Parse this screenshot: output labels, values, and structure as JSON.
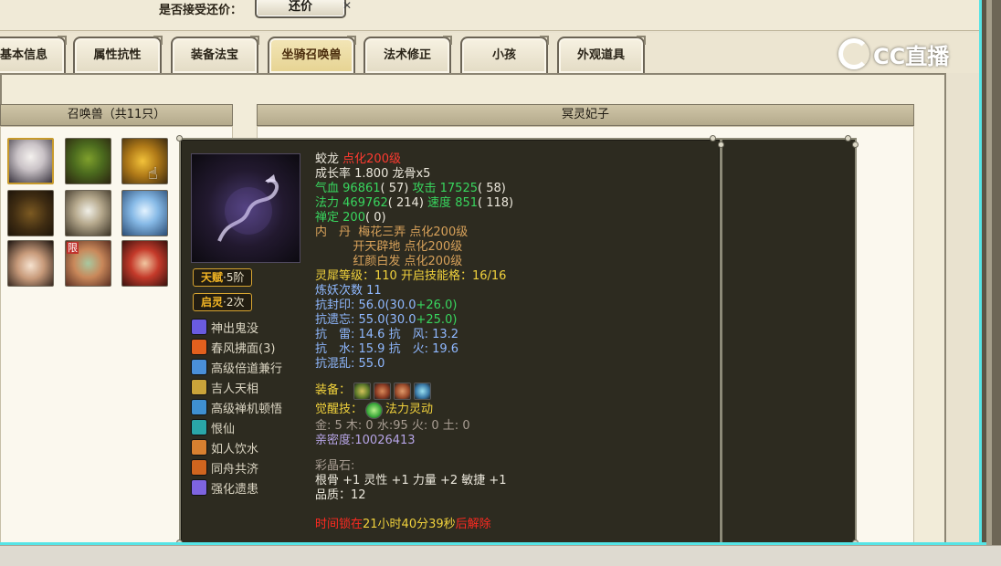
{
  "header": {
    "bargain_label": "是否接受还价：",
    "counter_button": "还价"
  },
  "tabs": [
    {
      "label": "基本信息"
    },
    {
      "label": "属性抗性"
    },
    {
      "label": "装备法宝"
    },
    {
      "label": "坐骑召唤兽",
      "active": true
    },
    {
      "label": "法术修正"
    },
    {
      "label": "小孩"
    },
    {
      "label": "外观道具"
    }
  ],
  "watermark": {
    "text": "CC直播"
  },
  "left_panel": {
    "title": "召唤兽（共11只）",
    "pets": [
      {
        "icon": "white-twin-beast-portrait",
        "selected": true
      },
      {
        "icon": "green-ogre-portrait"
      },
      {
        "icon": "golden-beast-portrait"
      },
      {
        "icon": "brown-beast-portrait"
      },
      {
        "icon": "armored-warrior-portrait"
      },
      {
        "icon": "ice-crystal-portrait"
      },
      {
        "icon": "lady-portrait"
      },
      {
        "icon": "fan-monk-portrait",
        "tag": "限"
      },
      {
        "icon": "red-kid-portrait"
      }
    ]
  },
  "right_panel": {
    "title": "冥灵妃子"
  },
  "tooltip": {
    "talent": {
      "name": "天赋",
      "level": "·5阶"
    },
    "enlighten": {
      "name": "启灵",
      "level": "·2次"
    },
    "skills": [
      {
        "name": "神出鬼没",
        "icon": "ghost-skill-icon",
        "color": "#6a5be0"
      },
      {
        "name": "春风拂面(3)",
        "icon": "flame-skill-icon",
        "color": "#e2601e"
      },
      {
        "name": "高级倍道兼行",
        "icon": "dash-skill-icon",
        "color": "#4a8fd8"
      },
      {
        "name": "吉人天相",
        "icon": "fortune-skill-icon",
        "color": "#c9a33a"
      },
      {
        "name": "高级禅机顿悟",
        "icon": "zen-skill-icon",
        "color": "#3f8fd0"
      },
      {
        "name": "恨仙",
        "icon": "ring-skill-icon",
        "color": "#2aa6a8"
      },
      {
        "name": "如人饮水",
        "icon": "water-skill-icon",
        "color": "#d88030"
      },
      {
        "name": "同舟共济",
        "icon": "boat-skill-icon",
        "color": "#d0651f"
      },
      {
        "name": "强化遗患",
        "icon": "curse-skill-icon",
        "color": "#7e64e0"
      }
    ],
    "stats": {
      "name": "蛟龙",
      "name_suffix": "点化200级",
      "growth_line": "成长率 1.800 龙骨x5",
      "hp_label": "气血",
      "hp_value": "96861",
      "hp_extra": "( 57)",
      "atk_label": "攻击",
      "atk_value": "17525",
      "atk_extra": "( 58)",
      "mp_label": "法力",
      "mp_value": "469762",
      "mp_extra": "( 214)",
      "spd_label": "速度",
      "spd_value": "851",
      "spd_extra": "( 118)",
      "zen_label": "禅定",
      "zen_value": "200",
      "zen_extra": "( 0)",
      "core_label": "内　丹",
      "core_1": "梅花三弄 点化200级",
      "core_2": "开天辟地 点化200级",
      "core_3": "红颜白发 点化200级",
      "spirit_line": "灵犀等级：110 开启技能格：16/16",
      "refine_label": "炼妖次数",
      "refine_value": "11",
      "seal_label": "抗封印:",
      "seal_a": "56.0(30.0",
      "seal_b": "+26.0)",
      "forget_label": "抗遗忘:",
      "forget_a": "55.0(30.0",
      "forget_b": "+25.0)",
      "thunder_line": "抗　雷: 14.6 抗　风: 13.2",
      "water_line": "抗　水: 15.9 抗　火: 19.6",
      "chaos_line": "抗混乱: 55.0",
      "equip_label": "装备：",
      "equip_icons": [
        "green-ring-equip-icon",
        "red-armor-equip-icon",
        "red-claw-equip-icon",
        "blue-gem-equip-icon"
      ],
      "awaken_label": "觉醒技：",
      "awaken_name": "法力灵动",
      "elements_line": "金: 5 木: 0 水:95 火: 0 土: 0",
      "intimacy_line": "亲密度:10026413",
      "crystal_title": "彩晶石:",
      "crystal_attrs": "根骨 +1 灵性 +1 力量 +2 敏捷 +1",
      "crystal_quality": "品质：12",
      "lock_a": "时间锁在",
      "lock_b": "21小时40分39秒",
      "lock_c": "后解除"
    }
  }
}
